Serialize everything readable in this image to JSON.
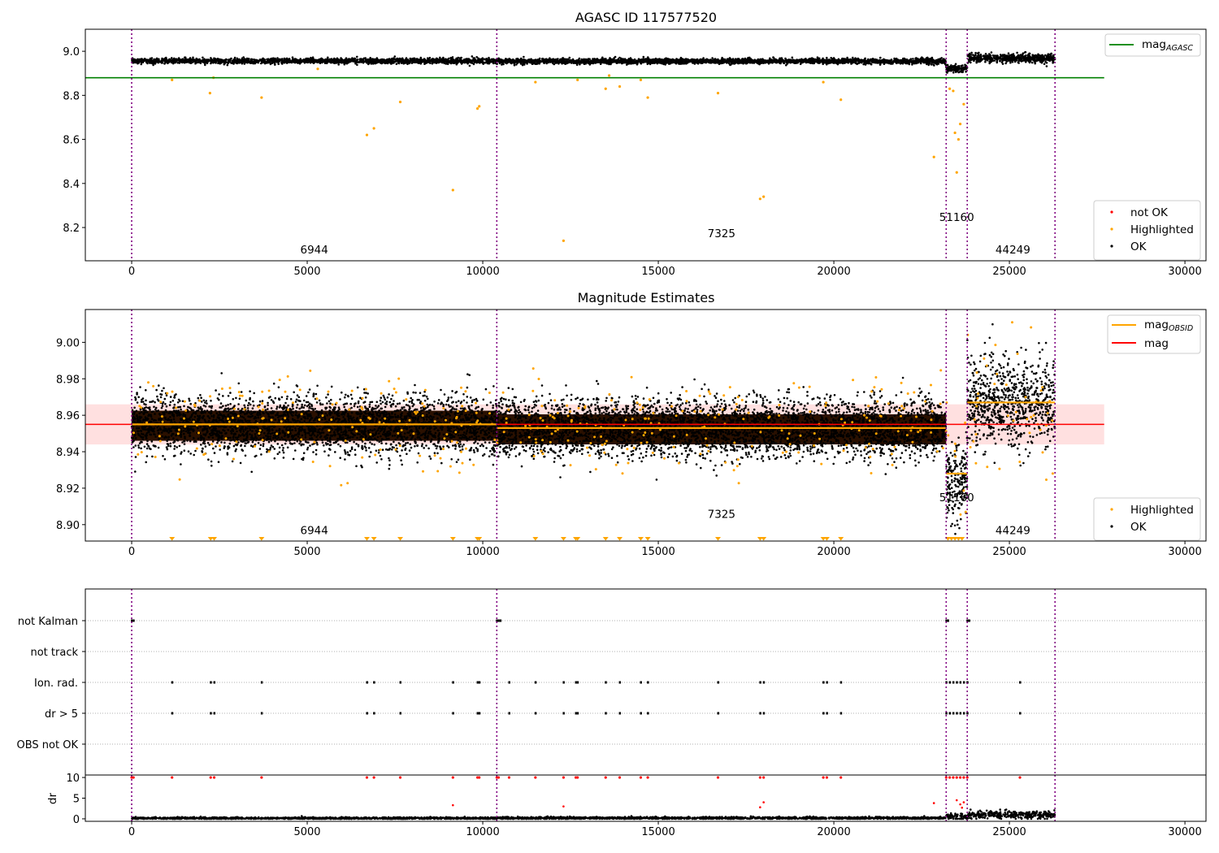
{
  "chart_data": [
    {
      "type": "scatter",
      "title": "AGASC ID 117577520",
      "xlim": [
        -1320,
        30600
      ],
      "ylim": [
        8.049,
        9.1
      ],
      "xticks": [
        0,
        5000,
        10000,
        15000,
        20000,
        25000,
        30000
      ],
      "yticks": [
        8.2,
        8.4,
        8.6,
        8.8,
        9.0
      ],
      "ytick_labels": [
        "8.2",
        "8.4",
        "8.6",
        "8.8",
        "9.0"
      ],
      "grid": false,
      "obsid_boundaries": [
        0,
        10400,
        23200,
        23800,
        26300
      ],
      "obsid_labels": [
        {
          "text": "6944",
          "x": 5200,
          "y": 8.1
        },
        {
          "text": "7325",
          "x": 16800,
          "y": 8.174
        },
        {
          "text": "51160",
          "x": 23500,
          "y": 8.248
        },
        {
          "text": "44249",
          "x": 25100,
          "y": 8.1
        }
      ],
      "hlines": [
        {
          "name": "mag_AGASC",
          "label_main": "mag",
          "label_sub": "AGASC",
          "y": 8.88,
          "x": [
            -1320,
            27700
          ],
          "color": "#008000"
        }
      ],
      "segments": [
        {
          "x": [
            0,
            10400
          ],
          "mean": 8.956,
          "sd": 0.006
        },
        {
          "x": [
            10400,
            23200
          ],
          "mean": 8.955,
          "sd": 0.006
        },
        {
          "x": [
            23200,
            23800
          ],
          "mean": 8.922,
          "sd": 0.008
        },
        {
          "x": [
            23800,
            26300
          ],
          "mean": 8.968,
          "sd": 0.01
        }
      ],
      "highlighted_outliers": [
        [
          1150,
          8.87
        ],
        [
          2230,
          8.81
        ],
        [
          2330,
          8.88
        ],
        [
          3700,
          8.79
        ],
        [
          5300,
          8.92
        ],
        [
          6700,
          8.62
        ],
        [
          6900,
          8.65
        ],
        [
          7650,
          8.77
        ],
        [
          9150,
          8.37
        ],
        [
          9850,
          8.74
        ],
        [
          9900,
          8.75
        ],
        [
          11500,
          8.86
        ],
        [
          12300,
          8.14
        ],
        [
          12700,
          8.87
        ],
        [
          13500,
          8.83
        ],
        [
          13600,
          8.89
        ],
        [
          13900,
          8.84
        ],
        [
          14500,
          8.87
        ],
        [
          14700,
          8.79
        ],
        [
          16700,
          8.81
        ],
        [
          17900,
          8.33
        ],
        [
          18000,
          8.34
        ],
        [
          19700,
          8.86
        ],
        [
          20200,
          8.78
        ],
        [
          22850,
          8.52
        ],
        [
          23300,
          8.83
        ],
        [
          23400,
          8.82
        ],
        [
          23450,
          8.63
        ],
        [
          23500,
          8.45
        ],
        [
          23550,
          8.6
        ],
        [
          23600,
          8.67
        ],
        [
          23700,
          8.76
        ]
      ],
      "legend_points": [
        "not OK",
        "Highlighted",
        "OK"
      ],
      "legend_position_lines": "upper right",
      "legend_position_points": "lower right"
    },
    {
      "type": "scatter",
      "title": "Magnitude Estimates",
      "xlim": [
        -1320,
        30600
      ],
      "ylim": [
        8.891,
        9.018
      ],
      "xticks": [
        0,
        5000,
        10000,
        15000,
        20000,
        25000,
        30000
      ],
      "yticks": [
        8.9,
        8.92,
        8.94,
        8.96,
        8.98,
        9.0
      ],
      "ytick_labels": [
        "8.90",
        "8.92",
        "8.94",
        "8.96",
        "8.98",
        "9.00"
      ],
      "grid": false,
      "obsid_labels": [
        {
          "text": "6944",
          "x": 5200,
          "y": 8.897
        },
        {
          "text": "7325",
          "x": 16800,
          "y": 8.906
        },
        {
          "text": "51160",
          "x": 23500,
          "y": 8.915
        },
        {
          "text": "44249",
          "x": 25100,
          "y": 8.897
        }
      ],
      "mag": {
        "label": "mag",
        "value": 8.955,
        "band": [
          8.944,
          8.966
        ],
        "x": [
          -1320,
          27700
        ],
        "color": "#ff0000"
      },
      "mag_obsid": {
        "label_main": "mag",
        "label_sub": "OBSID",
        "color": "#ffa500",
        "values": [
          {
            "x": [
              0,
              10400
            ],
            "y": 8.955
          },
          {
            "x": [
              10400,
              23200
            ],
            "y": 8.953
          },
          {
            "x": [
              23200,
              23800
            ],
            "y": 8.928
          },
          {
            "x": [
              23800,
              26300
            ],
            "y": 8.967
          }
        ]
      },
      "segments": [
        {
          "x": [
            0,
            10400
          ],
          "mean": 8.955,
          "sd": 0.008
        },
        {
          "x": [
            10400,
            23200
          ],
          "mean": 8.953,
          "sd": 0.008
        },
        {
          "x": [
            23200,
            23800
          ],
          "mean": 8.925,
          "sd": 0.011
        },
        {
          "x": [
            23800,
            26300
          ],
          "mean": 8.967,
          "sd": 0.012
        }
      ],
      "below_range_markers_x": [
        1150,
        2250,
        2350,
        3700,
        6700,
        6900,
        7650,
        9150,
        9850,
        9900,
        11500,
        12300,
        12650,
        12700,
        13500,
        13900,
        14500,
        14700,
        16700,
        17900,
        18000,
        19700,
        19800,
        20200,
        23250,
        23350,
        23450,
        23550,
        23650
      ],
      "legend_points": [
        "Highlighted",
        "OK"
      ],
      "legend_position_lines": "upper right",
      "legend_position_points": "lower right"
    },
    {
      "type": "scatter",
      "xlim": [
        -1320,
        30600
      ],
      "categories": [
        "not Kalman",
        "not track",
        "Ion. rad.",
        "dr > 5",
        "OBS not OK"
      ],
      "flag_points": {
        "not Kalman": [
          0,
          50,
          10400,
          10450,
          10500,
          23200,
          23250,
          23800,
          23850
        ],
        "not track": [],
        "Ion. rad.": [
          1150,
          2250,
          2350,
          3700,
          6700,
          6900,
          7650,
          9150,
          9850,
          9900,
          10750,
          11500,
          12300,
          12650,
          12700,
          13500,
          13900,
          14500,
          14700,
          16700,
          17900,
          18000,
          19700,
          19800,
          20200,
          23200,
          23300,
          23400,
          23500,
          23600,
          23700,
          23800,
          25300
        ],
        "dr > 5": [
          1150,
          2250,
          2350,
          3700,
          6700,
          6900,
          7650,
          9150,
          9850,
          9900,
          10750,
          11500,
          12300,
          12650,
          12700,
          13500,
          13900,
          14500,
          14700,
          16700,
          17900,
          18000,
          19700,
          19800,
          20200,
          23200,
          23300,
          23400,
          23500,
          23600,
          23700,
          23800,
          25300
        ],
        "OBS not OK": []
      },
      "dr": {
        "ylabel": "dr",
        "ylim": [
          -0.6,
          10.6
        ],
        "yticks": [
          0,
          5,
          10
        ],
        "ytick_labels": [
          "0",
          "5",
          "10"
        ],
        "xticks": [
          0,
          5000,
          10000,
          15000,
          20000,
          25000,
          30000
        ],
        "segments": [
          {
            "x": [
              0,
              10400
            ],
            "mean": 0.15,
            "sd": 0.12
          },
          {
            "x": [
              10400,
              23200
            ],
            "mean": 0.2,
            "sd": 0.14
          },
          {
            "x": [
              23200,
              23800
            ],
            "mean": 0.6,
            "sd": 0.4
          },
          {
            "x": [
              23800,
              26300
            ],
            "mean": 1.0,
            "sd": 0.45
          }
        ],
        "clipped_at_10_x": [
          0,
          50,
          1150,
          2250,
          2350,
          3700,
          6700,
          6900,
          7650,
          9150,
          9850,
          9900,
          10400,
          10450,
          10750,
          11500,
          12300,
          12650,
          12700,
          13500,
          13900,
          14500,
          14700,
          16700,
          17900,
          18000,
          19700,
          19800,
          20200,
          23200,
          23300,
          23400,
          23500,
          23600,
          23700,
          23800,
          25300
        ],
        "not_ok_points": [
          [
            9150,
            3.3
          ],
          [
            12300,
            3.0
          ],
          [
            17900,
            2.8
          ],
          [
            18000,
            4.0
          ],
          [
            22850,
            3.8
          ],
          [
            23500,
            4.5
          ],
          [
            23600,
            3.5
          ],
          [
            23650,
            2.7
          ],
          [
            23700,
            4.0
          ]
        ]
      }
    }
  ],
  "colors": {
    "ok": "#000000",
    "highlighted": "#ffa500",
    "not_ok": "#ff0000",
    "obsid_line": "#800080",
    "agasc": "#008000",
    "band": "#ffdddd"
  }
}
